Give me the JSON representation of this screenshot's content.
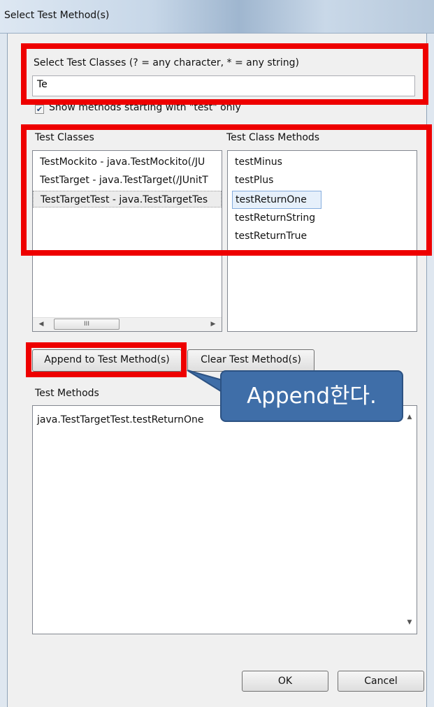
{
  "window": {
    "title": "Select Test Method(s)"
  },
  "filter": {
    "label": "Select Test Classes (? = any character, * = any string)",
    "value": "Te",
    "checkbox_label": "Show methods starting with \"test\" only",
    "checked": true
  },
  "classes": {
    "header": "Test Classes",
    "items": [
      "TestMockito - java.TestMockito(/JU",
      "TestTarget - java.TestTarget(/JUnitT",
      "TestTargetTest - java.TestTargetTes"
    ],
    "selected_index": 2,
    "scroll_thumb_glyph": "III"
  },
  "methods": {
    "header": "Test Class Methods",
    "items": [
      "testMinus",
      "testPlus",
      "testReturnOne",
      "testReturnString",
      "testReturnTrue"
    ],
    "selected_index": 2
  },
  "buttons": {
    "append": "Append to Test Method(s)",
    "clear": "Clear Test Method(s)",
    "ok": "OK",
    "cancel": "Cancel"
  },
  "test_methods": {
    "header": "Test Methods",
    "items": [
      "java.TestTargetTest.testReturnOne"
    ]
  },
  "annotation": {
    "callout_text": "Append한다.",
    "highlight_color": "#ee0000",
    "callout_color": "#3f6ea8"
  },
  "icons": {
    "check": "✔",
    "arrow_left": "◀",
    "arrow_right": "▶",
    "arrow_up": "▲",
    "arrow_down": "▼"
  }
}
